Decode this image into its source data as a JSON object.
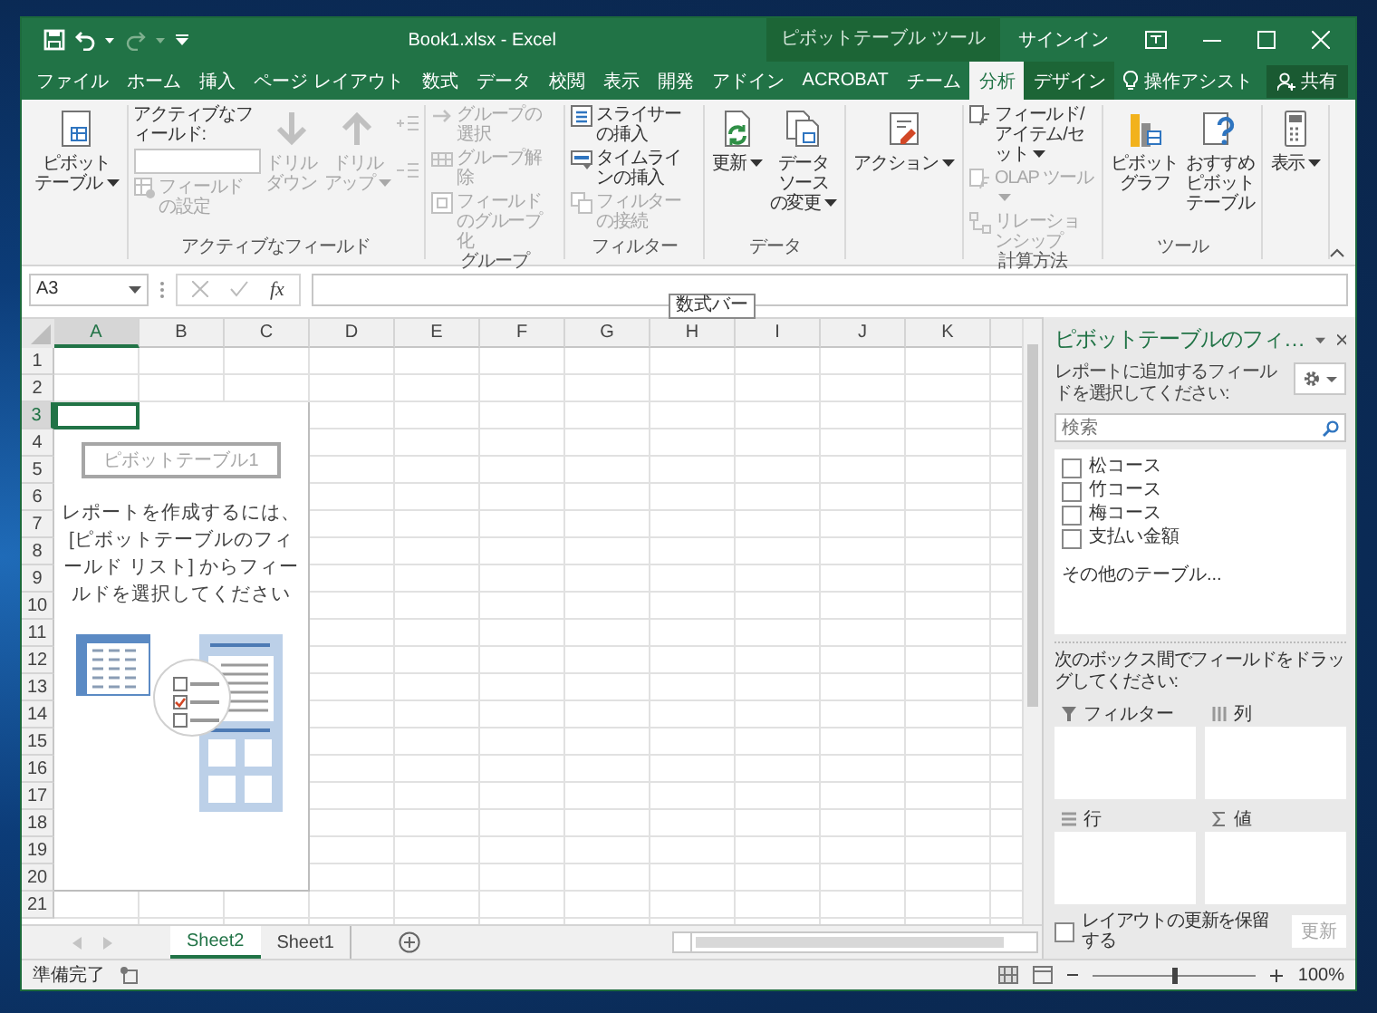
{
  "window": {
    "title": "Book1.xlsx - Excel",
    "context_group": "ピボットテーブル ツール",
    "sign_in": "サインイン"
  },
  "tabs": [
    {
      "label": "ファイル",
      "selected": false,
      "contextual": false
    },
    {
      "label": "ホーム",
      "selected": false,
      "contextual": false
    },
    {
      "label": "挿入",
      "selected": false,
      "contextual": false
    },
    {
      "label": "ページ レイアウト",
      "selected": false,
      "contextual": false
    },
    {
      "label": "数式",
      "selected": false,
      "contextual": false
    },
    {
      "label": "データ",
      "selected": false,
      "contextual": false
    },
    {
      "label": "校閲",
      "selected": false,
      "contextual": false
    },
    {
      "label": "表示",
      "selected": false,
      "contextual": false
    },
    {
      "label": "開発",
      "selected": false,
      "contextual": false
    },
    {
      "label": "アドイン",
      "selected": false,
      "contextual": false
    },
    {
      "label": "ACROBAT",
      "selected": false,
      "contextual": false
    },
    {
      "label": "チーム",
      "selected": false,
      "contextual": false
    },
    {
      "label": "分析",
      "selected": true,
      "contextual": true
    },
    {
      "label": "デザイン",
      "selected": false,
      "contextual": true
    }
  ],
  "tell_me": "操作アシスト",
  "share": "共有",
  "ribbon": [
    {
      "items": [
        {
          "kind": "large",
          "lines": [
            "ピボット",
            "テーブル"
          ],
          "caret": true,
          "disabled": false
        }
      ]
    },
    {
      "title": "アクティブなフィールド",
      "items": [
        {
          "kind": "stack",
          "items": [
            {
              "kind": "label",
              "label": "アクティブなフィールド:",
              "disabled": false
            },
            {
              "kind": "field"
            },
            {
              "kind": "small",
              "label": "フィールドの設定",
              "disabled": true
            }
          ]
        },
        {
          "kind": "large",
          "lines": [
            "ドリル",
            "ダウン"
          ],
          "disabled": true
        },
        {
          "kind": "large",
          "lines": [
            "ドリル",
            "アップ"
          ],
          "caret": true,
          "disabled": true
        },
        {
          "kind": "stack",
          "items": [
            {
              "kind": "icon",
              "disabled": true
            },
            {
              "kind": "icon",
              "disabled": true
            }
          ]
        }
      ]
    },
    {
      "title": "グループ",
      "items": [
        {
          "kind": "stack",
          "items": [
            {
              "kind": "small",
              "label": "グループの選択",
              "disabled": true
            },
            {
              "kind": "small",
              "label": "グループ解除",
              "disabled": true
            },
            {
              "kind": "small",
              "label": "フィールドのグループ化",
              "disabled": true
            }
          ]
        }
      ]
    },
    {
      "title": "フィルター",
      "items": [
        {
          "kind": "stack",
          "items": [
            {
              "kind": "small",
              "label": "スライサーの挿入",
              "disabled": false
            },
            {
              "kind": "small",
              "label": "タイムラインの挿入",
              "disabled": false
            },
            {
              "kind": "small",
              "label": "フィルターの接続",
              "disabled": true
            }
          ]
        }
      ]
    },
    {
      "title": "データ",
      "items": [
        {
          "kind": "large",
          "lines": [
            "更新"
          ],
          "caret": true,
          "disabled": false
        },
        {
          "kind": "large",
          "lines": [
            "データ",
            "ソース",
            "の変更"
          ],
          "caret": true,
          "disabled": false
        }
      ]
    },
    {
      "items": [
        {
          "kind": "large",
          "lines": [
            "アクション"
          ],
          "caret": true,
          "disabled": false
        }
      ]
    },
    {
      "title": "計算方法",
      "items": [
        {
          "kind": "stack",
          "items": [
            {
              "kind": "small",
              "label": "フィールド/アイテム/セット",
              "caret": true,
              "disabled": false
            },
            {
              "kind": "small",
              "label": "OLAP ツール",
              "caret": true,
              "disabled": true
            },
            {
              "kind": "small",
              "label": "リレーションシップ",
              "disabled": true
            }
          ]
        }
      ]
    },
    {
      "title": "ツール",
      "items": [
        {
          "kind": "large",
          "lines": [
            "ピボット",
            "グラフ"
          ],
          "disabled": false
        },
        {
          "kind": "large",
          "lines": [
            "おすすめ",
            "ピボット",
            "テーブル"
          ],
          "disabled": false
        }
      ]
    },
    {
      "items": [
        {
          "kind": "large",
          "lines": [
            "表示"
          ],
          "caret": true,
          "disabled": false
        }
      ]
    }
  ],
  "formula_bar": {
    "name_box": "A3",
    "insert_function": "fx"
  },
  "tooltip": "数式バー",
  "sheet": {
    "columns": [
      {
        "label": "A",
        "selected": true
      },
      {
        "label": "B",
        "selected": false
      },
      {
        "label": "C",
        "selected": false
      },
      {
        "label": "D",
        "selected": false
      },
      {
        "label": "E",
        "selected": false
      },
      {
        "label": "F",
        "selected": false
      },
      {
        "label": "G",
        "selected": false
      },
      {
        "label": "H",
        "selected": false
      },
      {
        "label": "I",
        "selected": false
      },
      {
        "label": "J",
        "selected": false
      },
      {
        "label": "K",
        "selected": false
      }
    ],
    "rows": [
      {
        "label": "1",
        "selected": false
      },
      {
        "label": "2",
        "selected": false
      },
      {
        "label": "3",
        "selected": true
      },
      {
        "label": "4",
        "selected": false
      },
      {
        "label": "5",
        "selected": false
      },
      {
        "label": "6",
        "selected": false
      },
      {
        "label": "7",
        "selected": false
      },
      {
        "label": "8",
        "selected": false
      },
      {
        "label": "9",
        "selected": false
      },
      {
        "label": "10",
        "selected": false
      },
      {
        "label": "11",
        "selected": false
      },
      {
        "label": "12",
        "selected": false
      },
      {
        "label": "13",
        "selected": false
      },
      {
        "label": "14",
        "selected": false
      },
      {
        "label": "15",
        "selected": false
      },
      {
        "label": "16",
        "selected": false
      },
      {
        "label": "17",
        "selected": false
      },
      {
        "label": "18",
        "selected": false
      },
      {
        "label": "19",
        "selected": false
      },
      {
        "label": "20",
        "selected": false
      },
      {
        "label": "21",
        "selected": false
      }
    ]
  },
  "pivot_placeholder": {
    "name": "ピボットテーブル1",
    "message": "レポートを作成するには、[ピボットテーブルのフィールド リスト] からフィールドを選択してください"
  },
  "sheet_tabs": [
    {
      "label": "Sheet2",
      "selected": true
    },
    {
      "label": "Sheet1",
      "selected": false
    }
  ],
  "field_pane": {
    "title": "ピボットテーブルのフィ…",
    "instruction": "レポートに追加するフィールドを選択してください:",
    "search_placeholder": "検索",
    "fields": [
      {
        "label": "松コース",
        "checked": false
      },
      {
        "label": "竹コース",
        "checked": false
      },
      {
        "label": "梅コース",
        "checked": false
      },
      {
        "label": "支払い金額",
        "checked": false
      }
    ],
    "more_tables": "その他のテーブル...",
    "drag_hint": "次のボックス間でフィールドをドラッグしてください:",
    "areas": [
      {
        "kind": "filter",
        "label": "フィルター"
      },
      {
        "kind": "columns",
        "label": "列"
      },
      {
        "kind": "rows",
        "label": "行"
      },
      {
        "kind": "values",
        "label": "値"
      }
    ],
    "defer_update": {
      "label": "レイアウトの更新を保留する",
      "checked": false
    },
    "update_button": {
      "label": "更新",
      "disabled": true
    }
  },
  "status_bar": {
    "text": "準備完了",
    "zoom_slider": {
      "level": 0.5
    },
    "zoom": "100%"
  }
}
